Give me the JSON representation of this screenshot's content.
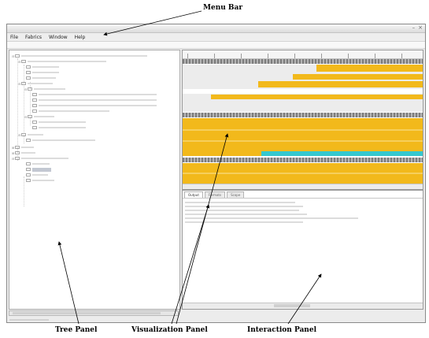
{
  "callouts": {
    "menu_bar": "Menu Bar",
    "tree_panel": "Tree Panel",
    "visualization_panel": "Visualization Panel",
    "interaction_panel": "Interaction Panel"
  },
  "menu": {
    "items": [
      "File",
      "Fabrics",
      "Window",
      "Help"
    ]
  },
  "interaction": {
    "tabs": [
      "Output",
      "Formats",
      "Scope"
    ]
  },
  "colors": {
    "track_yellow": "#f2b91b",
    "track_cyan": "#35c8cf",
    "selection": "#c3c8d2"
  },
  "icons": {
    "tree_folder": "folder-icon",
    "tree_file": "file-icon",
    "window_minimize": "minimize-icon",
    "window_close": "close-icon"
  }
}
